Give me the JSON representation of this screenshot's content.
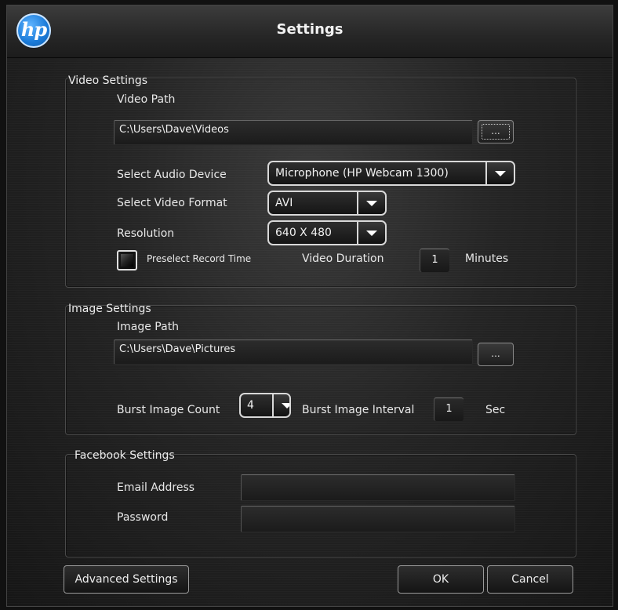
{
  "window": {
    "title": "Settings",
    "logo_text": "hp"
  },
  "video": {
    "group_title": "Video Settings",
    "path_label": "Video Path",
    "path_value": "C:\\Users\\Dave\\Videos",
    "browse_label": "...",
    "audio_label": "Select Audio Device",
    "audio_value": "Microphone (HP Webcam 1300)",
    "format_label": "Select Video Format",
    "format_value": "AVI",
    "resolution_label": "Resolution",
    "resolution_value": "640 X 480",
    "preselect_label": "Preselect Record Time",
    "preselect_checked": false,
    "duration_label": "Video Duration",
    "duration_value": "1",
    "duration_unit": "Minutes"
  },
  "image": {
    "group_title": "Image Settings",
    "path_label": "Image Path",
    "path_value": "C:\\Users\\Dave\\Pictures",
    "browse_label": "...",
    "burst_count_label": "Burst Image Count",
    "burst_count_value": "4",
    "burst_interval_label": "Burst Image Interval",
    "burst_interval_value": "1",
    "burst_interval_unit": "Sec"
  },
  "facebook": {
    "group_title": "Facebook Settings",
    "email_label": "Email Address",
    "email_value": "",
    "password_label": "Password",
    "password_value": ""
  },
  "buttons": {
    "advanced": "Advanced Settings",
    "ok": "OK",
    "cancel": "Cancel"
  }
}
